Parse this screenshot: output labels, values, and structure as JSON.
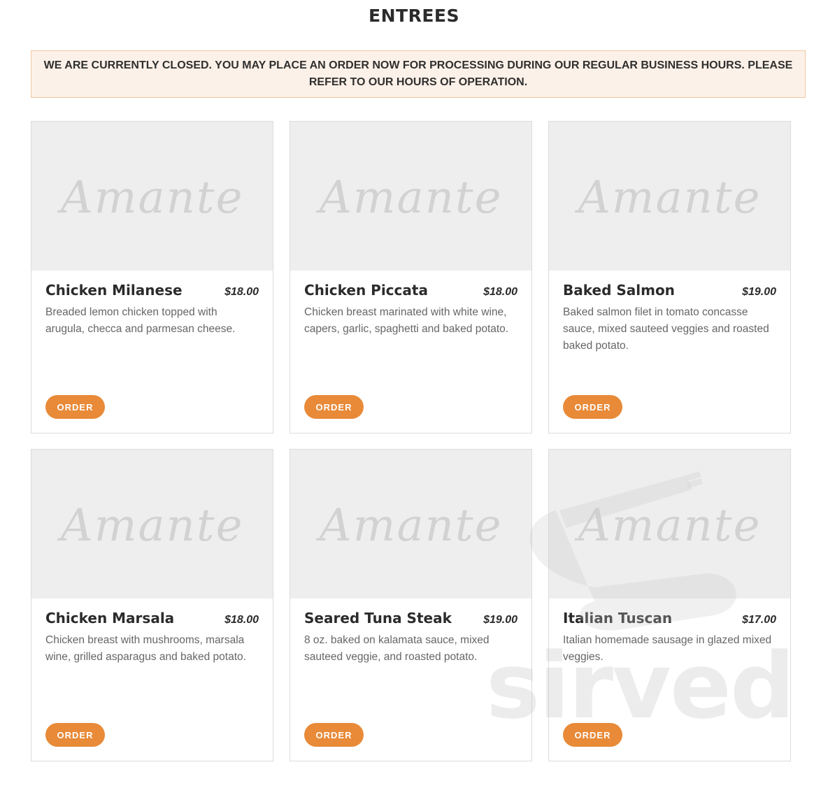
{
  "page": {
    "title": "ENTREES"
  },
  "notice": {
    "text": "WE ARE CURRENTLY CLOSED. YOU MAY PLACE AN ORDER NOW FOR PROCESSING DURING OUR REGULAR BUSINESS HOURS. PLEASE REFER TO OUR HOURS OF OPERATION."
  },
  "logo": {
    "text": "Amante"
  },
  "watermark": {
    "text": "sirved"
  },
  "items": [
    {
      "name": "Chicken Milanese",
      "price": "$18.00",
      "description": "Breaded lemon chicken topped with arugula, checca and parmesan cheese.",
      "button": "ORDER"
    },
    {
      "name": "Chicken Piccata",
      "price": "$18.00",
      "description": "Chicken breast marinated with white wine, capers, garlic, spaghetti and baked potato.",
      "button": "ORDER"
    },
    {
      "name": "Baked Salmon",
      "price": "$19.00",
      "description": "Baked salmon filet in tomato concasse sauce, mixed sauteed veggies and roasted baked potato.",
      "button": "ORDER"
    },
    {
      "name": "Chicken Marsala",
      "price": "$18.00",
      "description": "Chicken breast with mushrooms, marsala wine, grilled asparagus and baked potato.",
      "button": "ORDER"
    },
    {
      "name": "Seared Tuna Steak",
      "price": "$19.00",
      "description": "8 oz. baked on kalamata sauce, mixed sauteed veggie, and roasted potato.",
      "button": "ORDER"
    },
    {
      "name": "Italian Tuscan",
      "price": "$17.00",
      "description": "Italian homemade sausage in glazed mixed veggies.",
      "button": "ORDER"
    }
  ],
  "colors": {
    "accent": "#e88a38",
    "notice_bg": "#fcf1e8",
    "image_bg": "#eeeeee"
  }
}
